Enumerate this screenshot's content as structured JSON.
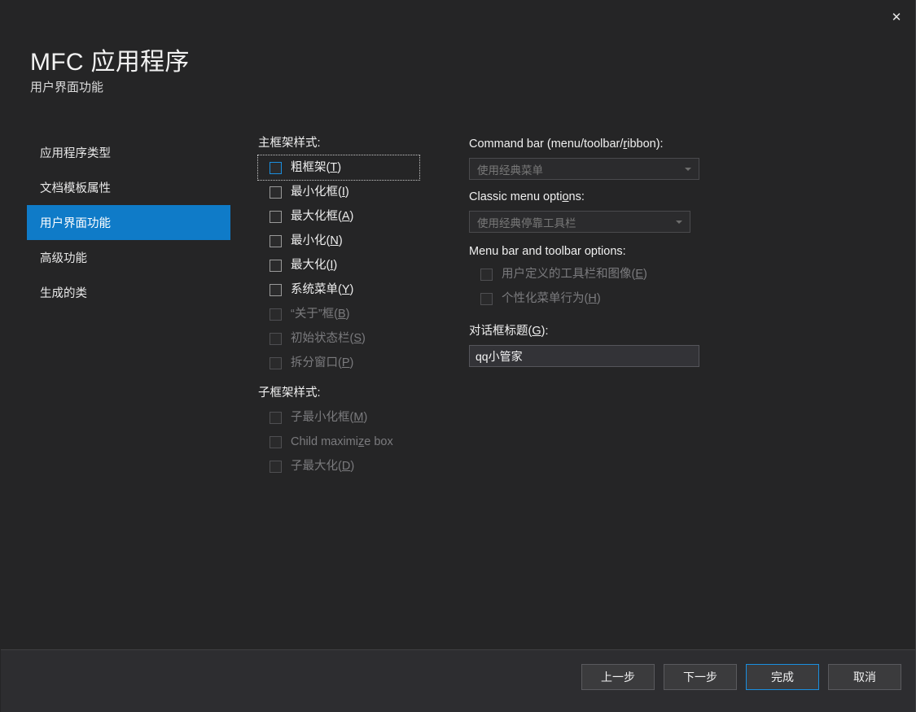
{
  "window": {
    "close_label": "✕"
  },
  "header": {
    "title": "MFC 应用程序",
    "subtitle": "用户界面功能"
  },
  "sidebar": {
    "items": [
      {
        "label": "应用程序类型",
        "active": false
      },
      {
        "label": "文档模板属性",
        "active": false
      },
      {
        "label": "用户界面功能",
        "active": true
      },
      {
        "label": "高级功能",
        "active": false
      },
      {
        "label": "生成的类",
        "active": false
      }
    ],
    "active_color": "#0f7bc8"
  },
  "main_frame_styles": {
    "label": "主框架样式:",
    "items": [
      {
        "label": "粗框架(T)",
        "accel": "T",
        "checked": false,
        "disabled": false,
        "focused": true
      },
      {
        "label": "最小化框(I)",
        "accel": "I",
        "checked": false,
        "disabled": false,
        "focused": false
      },
      {
        "label": "最大化框(A)",
        "accel": "A",
        "checked": false,
        "disabled": false,
        "focused": false
      },
      {
        "label": "最小化(N)",
        "accel": "N",
        "checked": false,
        "disabled": false,
        "focused": false
      },
      {
        "label": "最大化(I)",
        "accel": "I",
        "checked": false,
        "disabled": false,
        "focused": false
      },
      {
        "label": "系统菜单(Y)",
        "accel": "Y",
        "checked": false,
        "disabled": false,
        "focused": false
      },
      {
        "label": "“关于”框(B)",
        "accel": "B",
        "checked": false,
        "disabled": true,
        "focused": false
      },
      {
        "label": "初始状态栏(S)",
        "accel": "S",
        "checked": false,
        "disabled": true,
        "focused": false
      },
      {
        "label": "拆分窗口(P)",
        "accel": "P",
        "checked": false,
        "disabled": true,
        "focused": false
      }
    ]
  },
  "child_frame_styles": {
    "label": "子框架样式:",
    "items": [
      {
        "label": "子最小化框(M)",
        "accel": "M",
        "checked": false,
        "disabled": true,
        "focused": false
      },
      {
        "label": "Child maximize box",
        "accel": "z",
        "checked": false,
        "disabled": true,
        "focused": false
      },
      {
        "label": "子最大化(D)",
        "accel": "D",
        "checked": false,
        "disabled": true,
        "focused": false
      }
    ]
  },
  "command_bar": {
    "label": "Command bar (menu/toolbar/ribbon):",
    "accel": "r",
    "value": "使用经典菜单",
    "disabled": true
  },
  "classic_menu": {
    "label": "Classic menu options:",
    "accel": "o",
    "value": "使用经典停靠工具栏",
    "disabled": true
  },
  "menu_toolbar_options": {
    "label": "Menu bar and toolbar options:",
    "items": [
      {
        "label": "用户定义的工具栏和图像(E)",
        "accel": "E",
        "checked": false,
        "disabled": true
      },
      {
        "label": "个性化菜单行为(H)",
        "accel": "H",
        "checked": false,
        "disabled": true
      }
    ]
  },
  "dialog_title": {
    "label": "对话框标题(G)",
    "accel": "G",
    "value": "qq小管家"
  },
  "footer": {
    "buttons": [
      {
        "label": "上一步",
        "primary": false
      },
      {
        "label": "下一步",
        "primary": false
      },
      {
        "label": "完成",
        "primary": true
      },
      {
        "label": "取消",
        "primary": false
      }
    ]
  },
  "colors": {
    "background": "#252526",
    "footer_background": "#2d2d30",
    "accent": "#0f7bc8",
    "focus_border": "#1a8fe0"
  }
}
